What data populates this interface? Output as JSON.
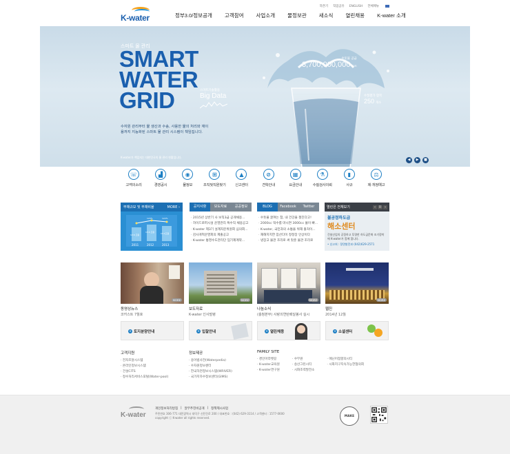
{
  "header": {
    "logo": "K-water",
    "utility": [
      "하관기",
      "직업공유",
      "ENGLISH",
      "전체메뉴"
    ],
    "nav": [
      "정부3.0/정보공개",
      "고객참여",
      "사업소개",
      "물정보관",
      "새소식",
      "열린채용",
      "K-water 소개"
    ]
  },
  "hero": {
    "subtitle": "스마트 물 관리",
    "title_lines": [
      "SMART",
      "WATER",
      "GRID"
    ],
    "description": "수자원 관리부터 물 생산과 수송, 사용한 물의 처리와 재이용까지 지능화된 스마트 물 관리 시스템이 책임집니다.",
    "big_data_label": "스마트기술활용",
    "big_data": "Big Data",
    "stat1_label": "수돗물 공급",
    "stat1_value": "3,700,000,000",
    "stat1_unit": "ton",
    "stat2_label": "수질평가 항목",
    "stat2_value": "250",
    "stat2_unit": "개소",
    "footnote": "K-water가 책임지는 대한민국의 물 관리 현황입니다.",
    "controls": [
      "◀",
      "▶",
      "■"
    ]
  },
  "quick_menu": [
    {
      "label": "고객의소리",
      "icon": "customer-voice-icon",
      "glyph": "☏"
    },
    {
      "label": "경영공시",
      "icon": "chart-icon",
      "glyph": "▟"
    },
    {
      "label": "물정보",
      "icon": "water-drop-icon",
      "glyph": "◉"
    },
    {
      "label": "조직및직원찾기",
      "icon": "org-chart-icon",
      "glyph": "⊞"
    },
    {
      "label": "신고센터",
      "icon": "siren-icon",
      "glyph": "▲"
    },
    {
      "label": "견학안내",
      "icon": "compass-icon",
      "glyph": "⊘"
    },
    {
      "label": "요금안내",
      "icon": "grid-icon",
      "glyph": "▦"
    },
    {
      "label": "수질검사의뢰",
      "icon": "flask-icon",
      "glyph": "⚗"
    },
    {
      "label": "사규",
      "icon": "book-icon",
      "glyph": "▮"
    },
    {
      "label": "제·개정예고",
      "icon": "gavel-icon",
      "glyph": "⚖"
    }
  ],
  "panel_debt": {
    "title": "부채규모 및 부채비율",
    "more": "MORE ›",
    "years": [
      "2011",
      "2012",
      "2013"
    ],
    "bar_labels": [
      "12.6 조원",
      "13.4 조원",
      "13.1조원"
    ],
    "ratio_labels": [
      "120%",
      "122%"
    ]
  },
  "panel_notice": {
    "tabs": [
      "공지사항",
      "보도자료",
      "공공정보"
    ],
    "items": [
      "2015년 상반기 사 보직3급 공개채용...",
      "하이드로퍼시설 운영관리 특수직 채용공고",
      "K-water 제3기 설계자문위원회 심의회...",
      "감사개혁운영회의 제출공고",
      "K-water 통영수도관리단 임기제계약..."
    ]
  },
  "panel_sns": {
    "tabs": [
      "BLOG",
      "Facebook",
      "Twitter"
    ],
    "items": [
      "수돗물 끓여는 참, 내 건강을 챙진다고!",
      "2000cc 먹수를 마시면 3000cc 물이 빠...",
      "K-water, 국민과의 소통을 위해 출처이...",
      "재해지지한 잠산다이 정정장 인상이다",
      "냉장고 물관 조리로 써 맛준 물관 조리로"
    ]
  },
  "panel_ad": {
    "header": "열린은 전체보기",
    "nav": [
      "‹",
      "II",
      "›"
    ],
    "line1": "불공정하도급",
    "line2": "해소센터",
    "line3": "건설산업의 공정하고 투명한 하도급문화 조기정착에 K-water가 함께 합니다.",
    "line4": "• 신고처 : 정면발전과 (042)629-2571"
  },
  "photos": [
    {
      "category": "동영상뉴스",
      "title": "코카스트 7월호",
      "more": "MORE"
    },
    {
      "category": "보도자료",
      "title": "K-water 인사발령",
      "more": "MORE"
    },
    {
      "category": "나눔소식",
      "title": "(충청본부) 사랑의연탄배달봉사 실시",
      "more": "MORE"
    },
    {
      "category": "웹진",
      "title": "2014년 12월",
      "more": "MORE"
    }
  ],
  "banners": [
    "토지분양안내",
    "입찰안내",
    "열린채용",
    "소셜센터"
  ],
  "links": {
    "customer": {
      "title": "고객지원",
      "items": [
        "전자조달시스템",
        "온라인정보시스템",
        "건설CITS",
        "정수처리서비스포털(Water-pool)"
      ]
    },
    "info": {
      "title": "정보제공",
      "items": [
        "용어법사전(Waterpedia)",
        "수자원정보센터",
        "한국하천정보시스템(WRIVER)",
        "국가지하수정보센터(GIMS)"
      ]
    },
    "family": {
      "title": "FAMILY SITE",
      "col1": [
        "경인아라뱃길",
        "K-water교육원",
        "K-water연구원"
      ],
      "col2": [
        "수무원",
        "송산그린시티",
        "시화조력발전소"
      ],
      "col3": [
        "에닌어점향의시티",
        "시화지구지속가능한협의회"
      ]
    }
  },
  "footer": {
    "logo": "K-water",
    "links": [
      "개인정보처리방침",
      "알무추진비공개",
      "정책제시사업"
    ],
    "address": "주민번호 306-771 대전광역시 대덕구 신탄진로 200 / 대표번호 : (042) 629-3114 / 고객센터 : 1577-0600",
    "copyright": "copyright ⓒ K-water all rights reserved.",
    "seal": "MAKE"
  },
  "colors": {
    "primary": "#1a5fae",
    "accent": "#2a8fd3",
    "orange": "#e08a1e"
  }
}
